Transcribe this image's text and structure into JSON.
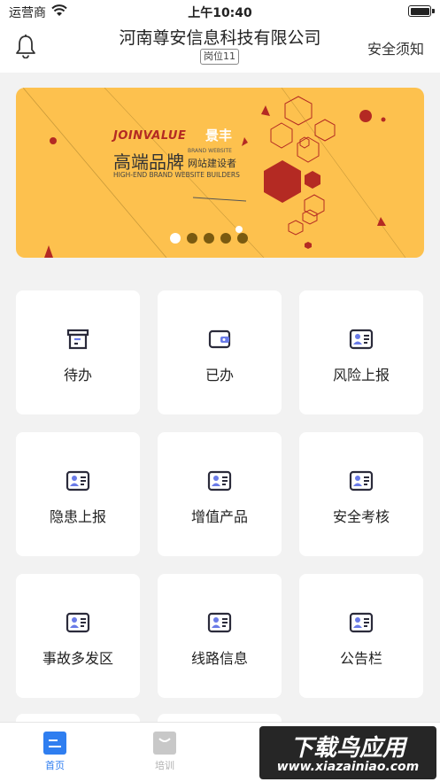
{
  "status_bar": {
    "carrier": "运营商",
    "time": "上午10:40"
  },
  "header": {
    "title": "河南尊安信息科技有限公司",
    "post": "岗位11",
    "notice_link": "安全须知"
  },
  "banner": {
    "brand_en": "JOINVALUE",
    "brand_cn": "景丰",
    "headline": "高端品牌",
    "sub_small": "BRAND WEBSITE",
    "sub_cn": "网站建设者",
    "sub_en": "HIGH-END BRAND WEBSITE BUILDERS",
    "slide_count": 5,
    "active_slide": 1,
    "colors": {
      "background": "#fdc14e",
      "accent": "#b42a23"
    }
  },
  "menu": [
    {
      "label": "待办",
      "icon": "archive-icon"
    },
    {
      "label": "已办",
      "icon": "wallet-icon"
    },
    {
      "label": "风险上报",
      "icon": "id-card-icon"
    },
    {
      "label": "隐患上报",
      "icon": "id-card-icon"
    },
    {
      "label": "增值产品",
      "icon": "id-card-icon"
    },
    {
      "label": "安全考核",
      "icon": "id-card-icon"
    },
    {
      "label": "事故多发区",
      "icon": "id-card-icon"
    },
    {
      "label": "线路信息",
      "icon": "id-card-icon"
    },
    {
      "label": "公告栏",
      "icon": "id-card-icon"
    }
  ],
  "tabbar": [
    {
      "label": "首页",
      "icon": "home-icon",
      "active": true
    },
    {
      "label": "培训",
      "icon": "training-icon",
      "active": false
    }
  ],
  "watermark": {
    "cn": "下载鸟应用",
    "url": "www.xiazainiao.com"
  },
  "colors": {
    "primary": "#2f7ef0",
    "icon_dark": "#2b2b3b",
    "icon_accent": "#6a7be8"
  }
}
